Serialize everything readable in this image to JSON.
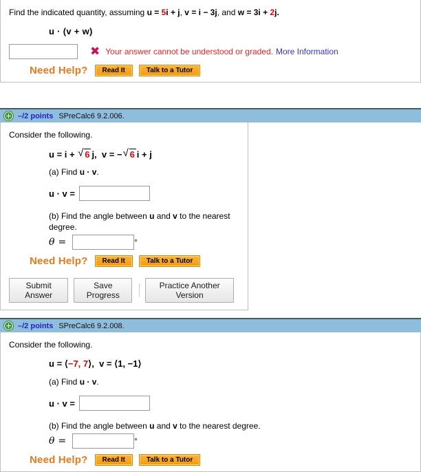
{
  "questions": [
    {
      "prompt_prefix": "Find the indicated quantity, assuming ",
      "u_label": "u",
      "u_eq": " = ",
      "u_red": "5",
      "u_rest": "i + j",
      "v_label": "v",
      "v_val": " = i − 3j",
      "and_text": ", and ",
      "w_label": "w",
      "w_val": " = 3",
      "w_red": "2",
      "w_tail": "j.",
      "expression": "u · (v + w)",
      "answer_value": "",
      "error_text": "Your answer cannot be understood or graded.",
      "error_link": "More Information",
      "x_mark": "✖",
      "need_help_label": "Need Help?",
      "read_it_label": "Read It",
      "tutor_label": "Talk to a Tutor"
    },
    {
      "points": "–/2 points",
      "qid": "SPreCalc6 9.2.006.",
      "consider": "Consider the following.",
      "u_label": "u",
      "u_pre": " = i + ",
      "u_radicand": "6",
      "u_post": "j,",
      "v_label": "v",
      "v_pre": " = −",
      "v_radicand": "6",
      "v_post": "i + j",
      "part_a": "(a) Find ",
      "part_a_u": "u",
      "part_a_dot": " · ",
      "part_a_v": "v",
      "part_a_end": ".",
      "dot_label_u": "u",
      "dot_label_dot": " · ",
      "dot_label_v": "v",
      "dot_label_eq": " =",
      "dot_answer": "",
      "part_b": "(b) Find the angle between ",
      "part_b_u": "u",
      "part_b_and": " and ",
      "part_b_v": "v",
      "part_b_end": " to the nearest degree.",
      "theta_symbol": "θ",
      "theta_eq": "=",
      "theta_answer": "",
      "degree_symbol": "°",
      "need_help_label": "Need Help?",
      "read_it_label": "Read It",
      "tutor_label": "Talk to a Tutor",
      "submit_label": "Submit Answer",
      "save_label": "Save Progress",
      "practice_label": "Practice Another Version"
    },
    {
      "points": "–/2 points",
      "qid": "SPreCalc6 9.2.008.",
      "consider": "Consider the following.",
      "u_label": "u",
      "u_eq": " = ",
      "u_open": "⟨",
      "u_comp": "−7, 7",
      "u_close": "⟩",
      "u_comma": ",",
      "v_label": "v",
      "v_eq": " = ",
      "v_open": "⟨",
      "v_comp": "1, −1",
      "v_close": "⟩",
      "part_a": "(a) Find ",
      "part_a_u": "u",
      "part_a_dot": " · ",
      "part_a_v": "v",
      "part_a_end": ".",
      "dot_label_u": "u",
      "dot_label_dot": " · ",
      "dot_label_v": "v",
      "dot_label_eq": " =",
      "dot_answer": "",
      "part_b": "(b) Find the angle between ",
      "part_b_u": "u",
      "part_b_and": " and ",
      "part_b_v": "v",
      "part_b_end": " to the nearest degree.",
      "theta_symbol": "θ",
      "theta_eq": "=",
      "theta_answer": "",
      "degree_symbol": "°",
      "need_help_label": "Need Help?",
      "read_it_label": "Read It",
      "tutor_label": "Talk to a Tutor"
    }
  ],
  "colors": {
    "header_blue": "#8fbedc",
    "points_blue": "#2222cc",
    "red_value": "#e8000b",
    "error_red": "#ee2222",
    "link_blue": "#3333cc",
    "help_orange": "#f07818",
    "plus_green": "#3a9e3a"
  }
}
